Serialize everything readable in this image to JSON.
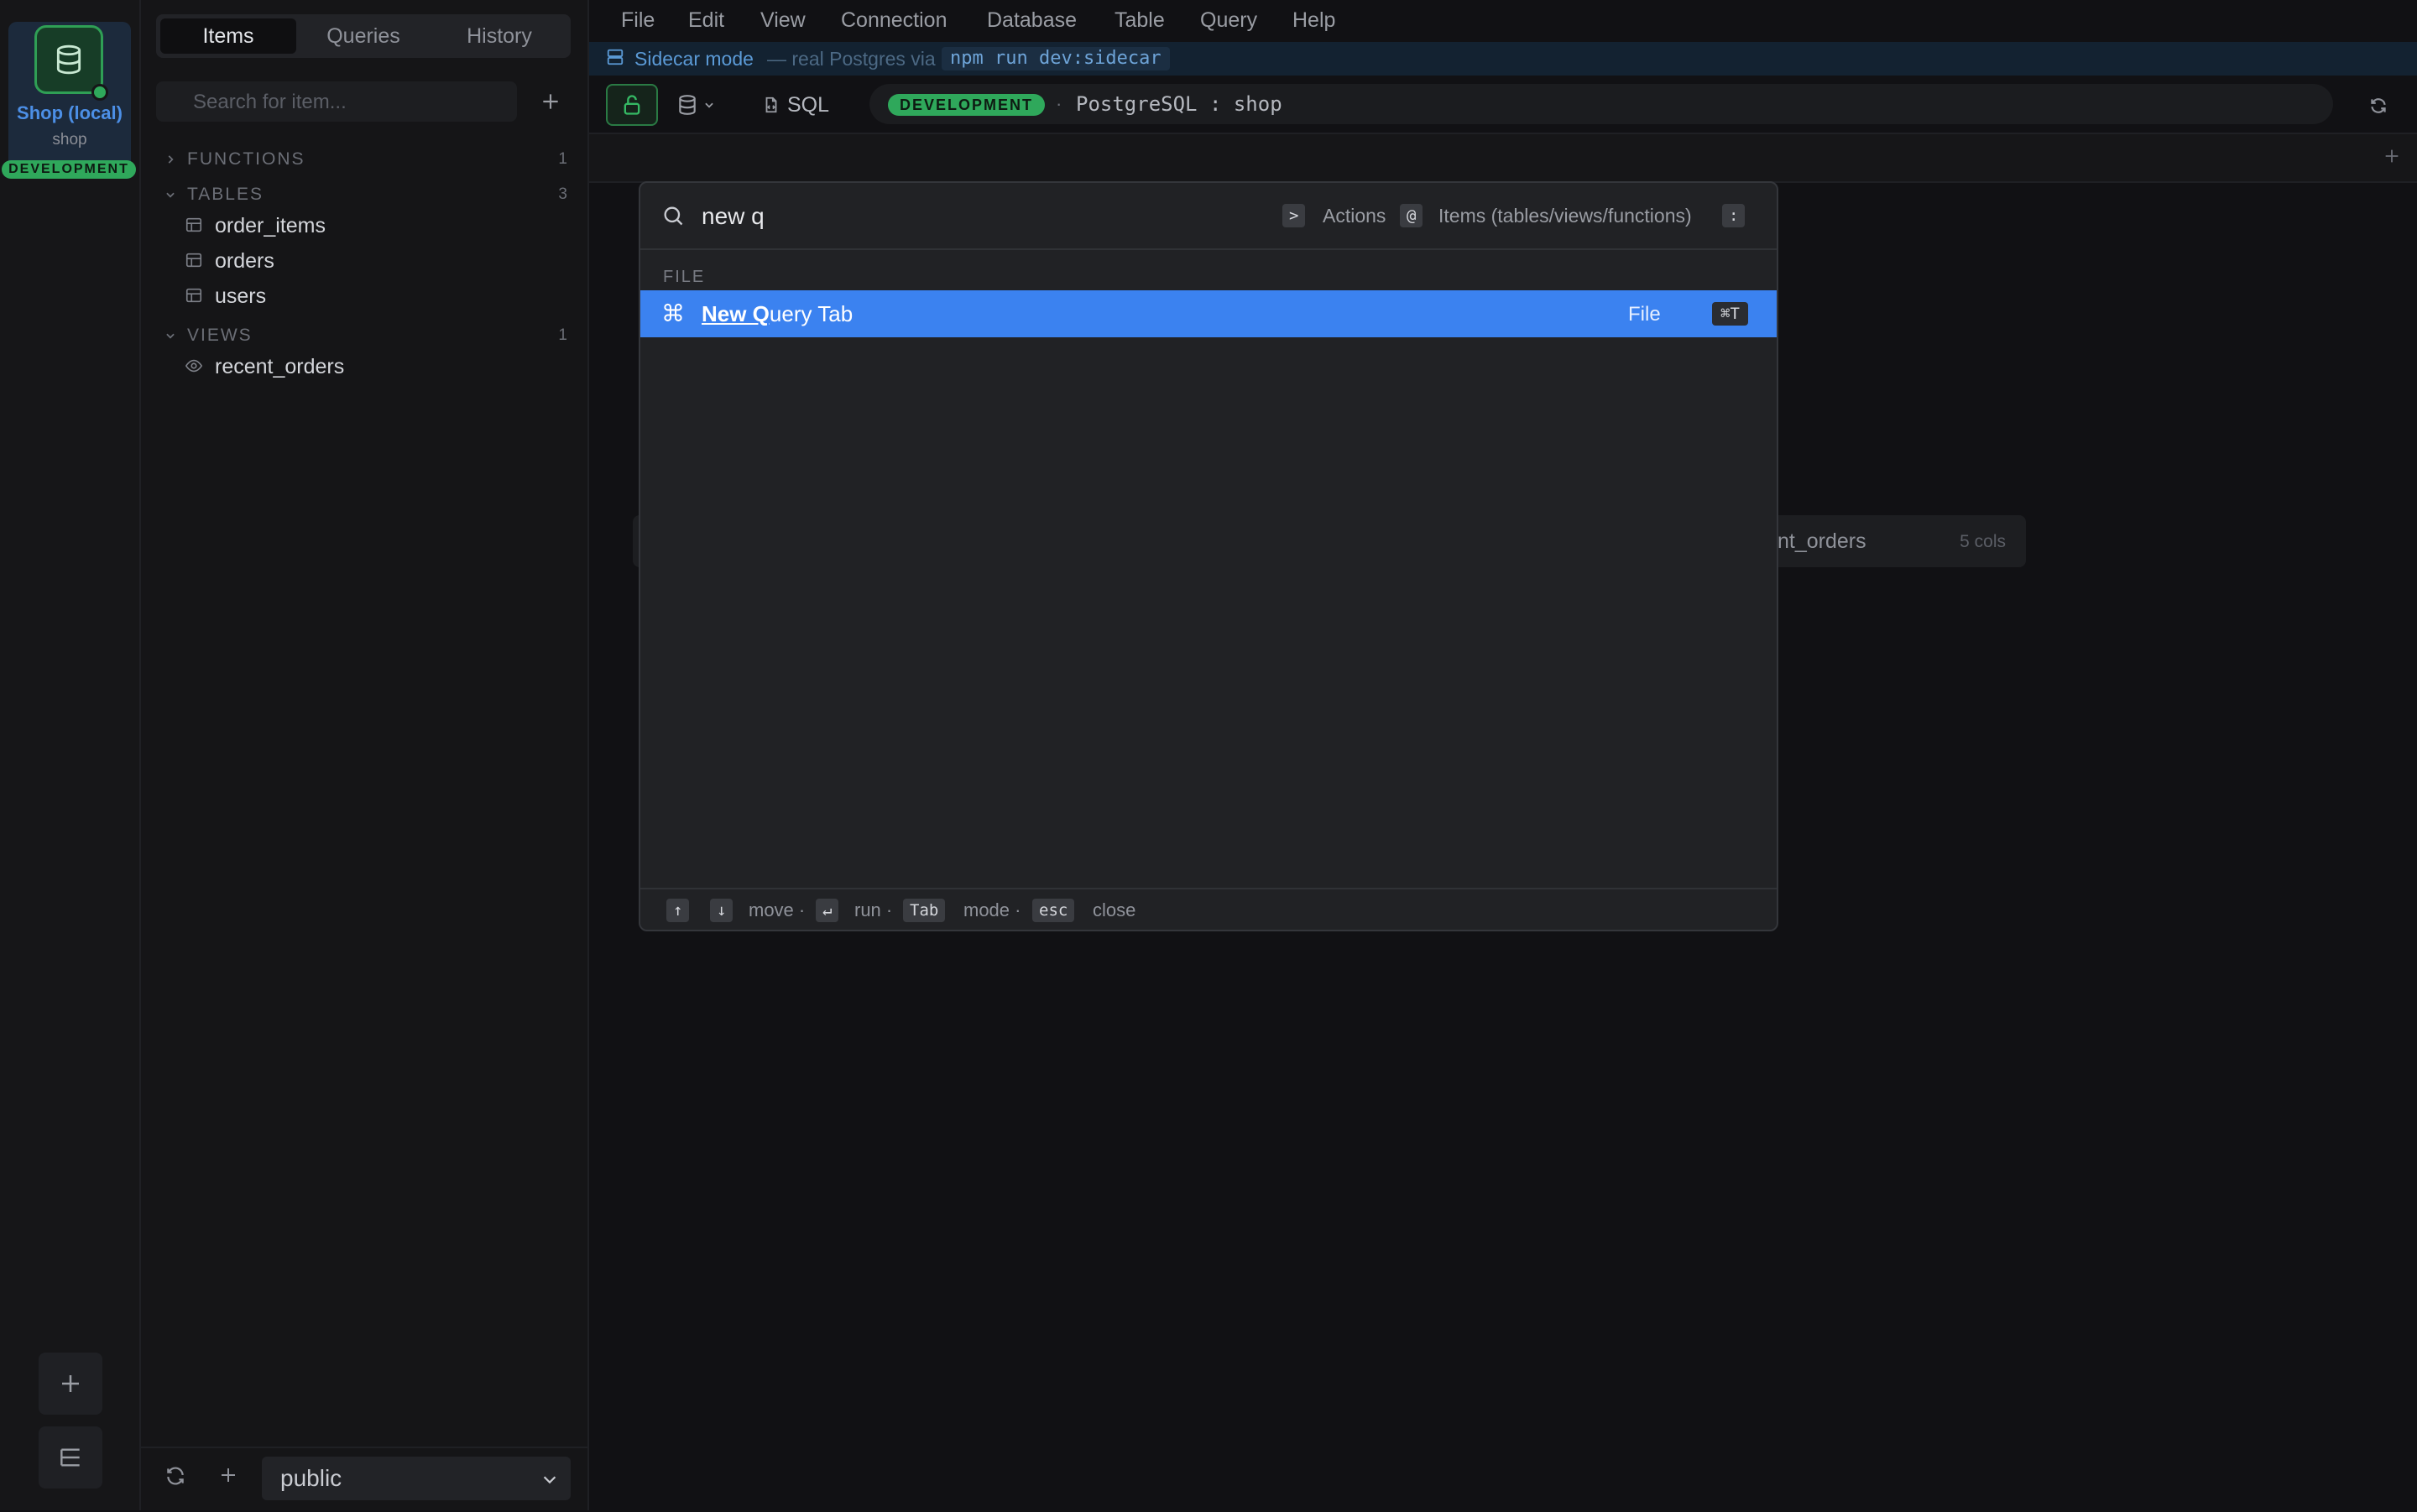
{
  "connection": {
    "name": "Shop (local)",
    "database": "shop",
    "environment": "DEVELOPMENT"
  },
  "sidebar": {
    "tabs": [
      "Items",
      "Queries",
      "History"
    ],
    "search_placeholder": "Search for item...",
    "sections": [
      {
        "label": "FUNCTIONS",
        "count": "1",
        "expanded": false,
        "items": []
      },
      {
        "label": "TABLES",
        "count": "3",
        "expanded": true,
        "items": [
          "order_items",
          "orders",
          "users"
        ]
      },
      {
        "label": "VIEWS",
        "count": "1",
        "expanded": true,
        "items": [
          "recent_orders"
        ]
      }
    ],
    "schema": "public"
  },
  "menubar": [
    "File",
    "Edit",
    "View",
    "Connection",
    "Database",
    "Table",
    "Query",
    "Help"
  ],
  "sidecar": {
    "title": "Sidecar mode",
    "subtitle": "— real Postgres via",
    "command": "npm run dev:sidecar"
  },
  "toolbar": {
    "sql_label": "SQL",
    "env_badge": "DEVELOPMENT",
    "separator": "·",
    "connection_info": "PostgreSQL : shop"
  },
  "background_card": {
    "name": "nt_orders",
    "cols": "5 cols"
  },
  "palette": {
    "query": "new q",
    "hints": [
      {
        "key": ">",
        "label": "Actions"
      },
      {
        "key": "@",
        "label": "Items (tables/views/functions)"
      },
      {
        "key": ":",
        "label": ""
      }
    ],
    "group": "FILE",
    "result": {
      "icon": "⌘",
      "match": "New Q",
      "rest": "uery Tab",
      "category": "File",
      "shortcut": "⌘T"
    },
    "footer": [
      {
        "keys": [
          "↑",
          "↓"
        ],
        "label": "move ·"
      },
      {
        "keys": [
          "↵"
        ],
        "label": "run ·"
      },
      {
        "keys": [
          "Tab"
        ],
        "label": "mode ·"
      },
      {
        "keys": [
          "esc"
        ],
        "label": "close"
      }
    ]
  },
  "colors": {
    "accent": "#3b82f0",
    "environment": "#2fa85b",
    "background": "#111114"
  }
}
